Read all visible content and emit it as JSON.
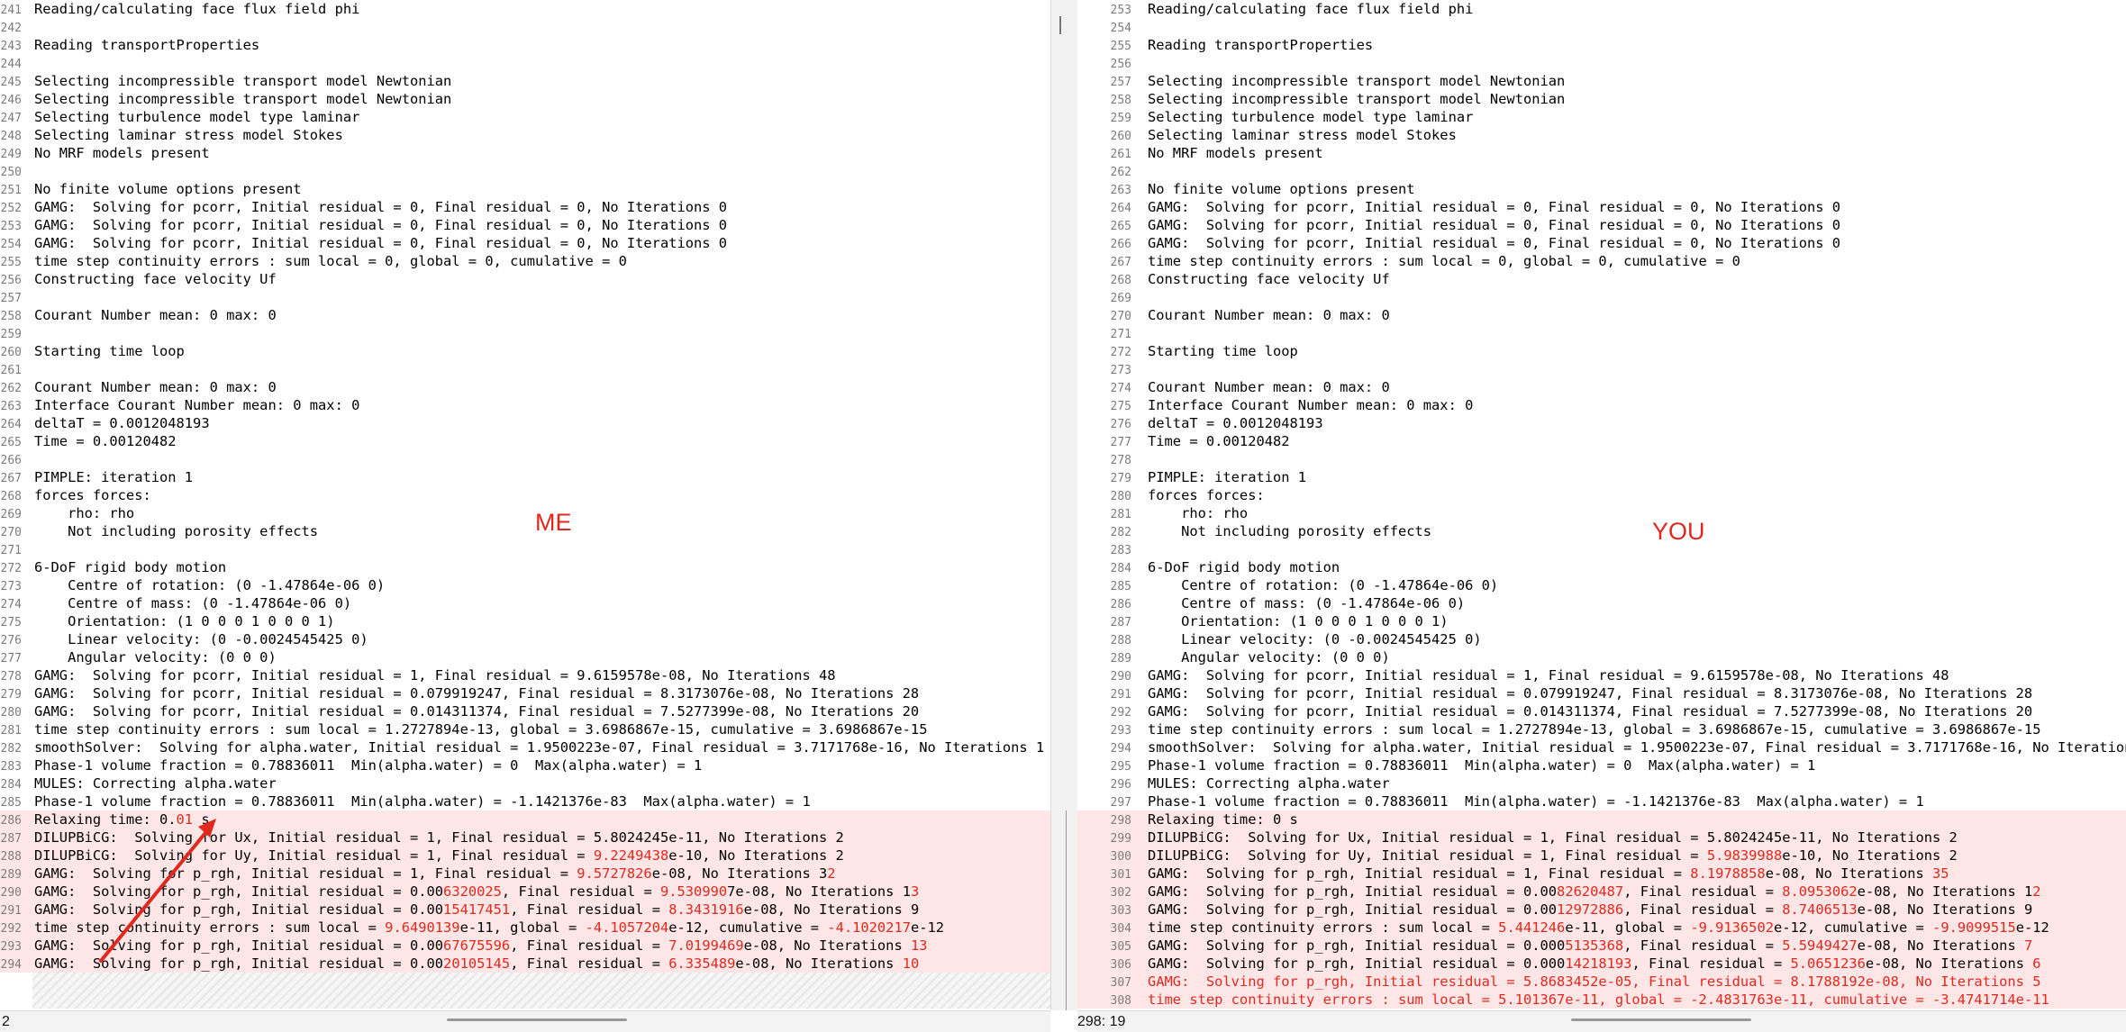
{
  "left": {
    "note": "ME",
    "status_text": "2",
    "lines": [
      {
        "n": "241",
        "text": "Reading/calculating face flux field phi"
      },
      {
        "n": "242",
        "text": ""
      },
      {
        "n": "243",
        "text": "Reading transportProperties"
      },
      {
        "n": "244",
        "text": ""
      },
      {
        "n": "245",
        "text": "Selecting incompressible transport model Newtonian"
      },
      {
        "n": "246",
        "text": "Selecting incompressible transport model Newtonian"
      },
      {
        "n": "247",
        "text": "Selecting turbulence model type laminar"
      },
      {
        "n": "248",
        "text": "Selecting laminar stress model Stokes"
      },
      {
        "n": "249",
        "text": "No MRF models present"
      },
      {
        "n": "250",
        "text": ""
      },
      {
        "n": "251",
        "text": "No finite volume options present"
      },
      {
        "n": "252",
        "text": "GAMG:  Solving for pcorr, Initial residual = 0, Final residual = 0, No Iterations 0"
      },
      {
        "n": "253",
        "text": "GAMG:  Solving for pcorr, Initial residual = 0, Final residual = 0, No Iterations 0"
      },
      {
        "n": "254",
        "text": "GAMG:  Solving for pcorr, Initial residual = 0, Final residual = 0, No Iterations 0"
      },
      {
        "n": "255",
        "text": "time step continuity errors : sum local = 0, global = 0, cumulative = 0"
      },
      {
        "n": "256",
        "text": "Constructing face velocity Uf"
      },
      {
        "n": "257",
        "text": ""
      },
      {
        "n": "258",
        "text": "Courant Number mean: 0 max: 0"
      },
      {
        "n": "259",
        "text": ""
      },
      {
        "n": "260",
        "text": "Starting time loop"
      },
      {
        "n": "261",
        "text": ""
      },
      {
        "n": "262",
        "text": "Courant Number mean: 0 max: 0"
      },
      {
        "n": "263",
        "text": "Interface Courant Number mean: 0 max: 0"
      },
      {
        "n": "264",
        "text": "deltaT = 0.0012048193"
      },
      {
        "n": "265",
        "text": "Time = 0.00120482"
      },
      {
        "n": "266",
        "text": ""
      },
      {
        "n": "267",
        "text": "PIMPLE: iteration 1"
      },
      {
        "n": "268",
        "text": "forces forces:"
      },
      {
        "n": "269",
        "text": "    rho: rho"
      },
      {
        "n": "270",
        "text": "    Not including porosity effects"
      },
      {
        "n": "271",
        "text": ""
      },
      {
        "n": "272",
        "text": "6-DoF rigid body motion"
      },
      {
        "n": "273",
        "text": "    Centre of rotation: (0 -1.47864e-06 0)"
      },
      {
        "n": "274",
        "text": "    Centre of mass: (0 -1.47864e-06 0)"
      },
      {
        "n": "275",
        "text": "    Orientation: (1 0 0 0 1 0 0 0 1)"
      },
      {
        "n": "276",
        "text": "    Linear velocity: (0 -0.0024545425 0)"
      },
      {
        "n": "277",
        "text": "    Angular velocity: (0 0 0)"
      },
      {
        "n": "278",
        "text": "GAMG:  Solving for pcorr, Initial residual = 1, Final residual = 9.6159578e-08, No Iterations 48"
      },
      {
        "n": "279",
        "text": "GAMG:  Solving for pcorr, Initial residual = 0.079919247, Final residual = 8.3173076e-08, No Iterations 28"
      },
      {
        "n": "280",
        "text": "GAMG:  Solving for pcorr, Initial residual = 0.014311374, Final residual = 7.5277399e-08, No Iterations 20"
      },
      {
        "n": "281",
        "text": "time step continuity errors : sum local = 1.2727894e-13, global = 3.6986867e-15, cumulative = 3.6986867e-15"
      },
      {
        "n": "282",
        "text": "smoothSolver:  Solving for alpha.water, Initial residual = 1.9500223e-07, Final residual = 3.7171768e-16, No Iterations 1"
      },
      {
        "n": "283",
        "text": "Phase-1 volume fraction = 0.78836011  Min(alpha.water) = 0  Max(alpha.water) = 1"
      },
      {
        "n": "284",
        "text": "MULES: Correcting alpha.water"
      },
      {
        "n": "285",
        "text": "Phase-1 volume fraction = 0.78836011  Min(alpha.water) = -1.1421376e-83  Max(alpha.water) = 1"
      },
      {
        "n": "286",
        "diff": true,
        "parts": [
          "Relaxing time: 0.",
          {
            "hl": "01"
          },
          " s"
        ]
      },
      {
        "n": "287",
        "diff": true,
        "text": "DILUPBiCG:  Solving for Ux, Initial residual = 1, Final residual = 5.8024245e-11, No Iterations 2"
      },
      {
        "n": "288",
        "diff": true,
        "parts": [
          "DILUPBiCG:  Solving for Uy, Initial residual = 1, Final residual = ",
          {
            "hl": "9.2249438"
          },
          "e-10, No Iterations 2"
        ]
      },
      {
        "n": "289",
        "diff": true,
        "parts": [
          "GAMG:  Solving for p_rgh, Initial residual = 1, Final residual = ",
          {
            "hl": "9.5727826"
          },
          "e-08, No Iterations 3",
          {
            "hl": "2"
          }
        ]
      },
      {
        "n": "290",
        "diff": true,
        "parts": [
          "GAMG:  Solving for p_rgh, Initial residual = 0.00",
          {
            "hl": "6320025"
          },
          ", Final residual = ",
          {
            "hl": "9.530990"
          },
          "7e-08, No Iterations 1",
          {
            "hl": "3"
          }
        ]
      },
      {
        "n": "291",
        "diff": true,
        "parts": [
          "GAMG:  Solving for p_rgh, Initial residual = 0.00",
          {
            "hl": "15417451"
          },
          ", Final residual = ",
          {
            "hl": "8.3431916"
          },
          "e-08, No Iterations 9"
        ]
      },
      {
        "n": "292",
        "diff": true,
        "parts": [
          "time step continuity errors : sum local = ",
          {
            "hl": "9.6490139"
          },
          "e-11, global = ",
          {
            "hl": "-4.1057204"
          },
          "e-12, cumulative = ",
          {
            "hl": "-4.1020217"
          },
          "e-12"
        ]
      },
      {
        "n": "293",
        "diff": true,
        "parts": [
          "GAMG:  Solving for p_rgh, Initial residual = 0.00",
          {
            "hl": "67675596"
          },
          ", Final residual = ",
          {
            "hl": "7.0199469"
          },
          "e-08, No Iterations ",
          {
            "hl": "13"
          }
        ]
      },
      {
        "n": "294",
        "diff": true,
        "parts": [
          "GAMG:  Solving for p_rgh, Initial residual = 0.00",
          {
            "hl": "20105145"
          },
          ", Final residual = ",
          {
            "hl": "6.335489"
          },
          "e-08, No Iterations ",
          {
            "hl": "10"
          }
        ]
      }
    ]
  },
  "right": {
    "note": "YOU",
    "status_text": "298: 19",
    "lines": [
      {
        "n": "253",
        "text": "Reading/calculating face flux field phi"
      },
      {
        "n": "254",
        "text": ""
      },
      {
        "n": "255",
        "text": "Reading transportProperties"
      },
      {
        "n": "256",
        "text": ""
      },
      {
        "n": "257",
        "text": "Selecting incompressible transport model Newtonian"
      },
      {
        "n": "258",
        "text": "Selecting incompressible transport model Newtonian"
      },
      {
        "n": "259",
        "text": "Selecting turbulence model type laminar"
      },
      {
        "n": "260",
        "text": "Selecting laminar stress model Stokes"
      },
      {
        "n": "261",
        "text": "No MRF models present"
      },
      {
        "n": "262",
        "text": ""
      },
      {
        "n": "263",
        "text": "No finite volume options present"
      },
      {
        "n": "264",
        "text": "GAMG:  Solving for pcorr, Initial residual = 0, Final residual = 0, No Iterations 0"
      },
      {
        "n": "265",
        "text": "GAMG:  Solving for pcorr, Initial residual = 0, Final residual = 0, No Iterations 0"
      },
      {
        "n": "266",
        "text": "GAMG:  Solving for pcorr, Initial residual = 0, Final residual = 0, No Iterations 0"
      },
      {
        "n": "267",
        "text": "time step continuity errors : sum local = 0, global = 0, cumulative = 0"
      },
      {
        "n": "268",
        "text": "Constructing face velocity Uf"
      },
      {
        "n": "269",
        "text": ""
      },
      {
        "n": "270",
        "text": "Courant Number mean: 0 max: 0"
      },
      {
        "n": "271",
        "text": ""
      },
      {
        "n": "272",
        "text": "Starting time loop"
      },
      {
        "n": "273",
        "text": ""
      },
      {
        "n": "274",
        "text": "Courant Number mean: 0 max: 0"
      },
      {
        "n": "275",
        "text": "Interface Courant Number mean: 0 max: 0"
      },
      {
        "n": "276",
        "text": "deltaT = 0.0012048193"
      },
      {
        "n": "277",
        "text": "Time = 0.00120482"
      },
      {
        "n": "278",
        "text": ""
      },
      {
        "n": "279",
        "text": "PIMPLE: iteration 1"
      },
      {
        "n": "280",
        "text": "forces forces:"
      },
      {
        "n": "281",
        "text": "    rho: rho"
      },
      {
        "n": "282",
        "text": "    Not including porosity effects"
      },
      {
        "n": "283",
        "text": ""
      },
      {
        "n": "284",
        "text": "6-DoF rigid body motion"
      },
      {
        "n": "285",
        "text": "    Centre of rotation: (0 -1.47864e-06 0)"
      },
      {
        "n": "286",
        "text": "    Centre of mass: (0 -1.47864e-06 0)"
      },
      {
        "n": "287",
        "text": "    Orientation: (1 0 0 0 1 0 0 0 1)"
      },
      {
        "n": "288",
        "text": "    Linear velocity: (0 -0.0024545425 0)"
      },
      {
        "n": "289",
        "text": "    Angular velocity: (0 0 0)"
      },
      {
        "n": "290",
        "text": "GAMG:  Solving for pcorr, Initial residual = 1, Final residual = 9.6159578e-08, No Iterations 48"
      },
      {
        "n": "291",
        "text": "GAMG:  Solving for pcorr, Initial residual = 0.079919247, Final residual = 8.3173076e-08, No Iterations 28"
      },
      {
        "n": "292",
        "text": "GAMG:  Solving for pcorr, Initial residual = 0.014311374, Final residual = 7.5277399e-08, No Iterations 20"
      },
      {
        "n": "293",
        "text": "time step continuity errors : sum local = 1.2727894e-13, global = 3.6986867e-15, cumulative = 3.6986867e-15"
      },
      {
        "n": "294",
        "text": "smoothSolver:  Solving for alpha.water, Initial residual = 1.9500223e-07, Final residual = 3.7171768e-16, No Iterations"
      },
      {
        "n": "295",
        "text": "Phase-1 volume fraction = 0.78836011  Min(alpha.water) = 0  Max(alpha.water) = 1"
      },
      {
        "n": "296",
        "text": "MULES: Correcting alpha.water"
      },
      {
        "n": "297",
        "text": "Phase-1 volume fraction = 0.78836011  Min(alpha.water) = -1.1421376e-83  Max(alpha.water) = 1"
      },
      {
        "n": "298",
        "diff": true,
        "text": "Relaxing time: 0 s"
      },
      {
        "n": "299",
        "diff": true,
        "text": "DILUPBiCG:  Solving for Ux, Initial residual = 1, Final residual = 5.8024245e-11, No Iterations 2"
      },
      {
        "n": "300",
        "diff": true,
        "parts": [
          "DILUPBiCG:  Solving for Uy, Initial residual = 1, Final residual = ",
          {
            "hl": "5.9839988"
          },
          "e-10, No Iterations 2"
        ]
      },
      {
        "n": "301",
        "diff": true,
        "parts": [
          "GAMG:  Solving for p_rgh, Initial residual = 1, Final residual = ",
          {
            "hl": "8.1978858"
          },
          "e-08, No Iterations ",
          {
            "hl": "35"
          }
        ]
      },
      {
        "n": "302",
        "diff": true,
        "parts": [
          "GAMG:  Solving for p_rgh, Initial residual = 0.00",
          {
            "hl": "82620487"
          },
          ", Final residual = ",
          {
            "hl": "8.0953062"
          },
          "e-08, No Iterations 1",
          {
            "hl": "2"
          }
        ]
      },
      {
        "n": "303",
        "diff": true,
        "parts": [
          "GAMG:  Solving for p_rgh, Initial residual = 0.00",
          {
            "hl": "12972886"
          },
          ", Final residual = ",
          {
            "hl": "8.7406513"
          },
          "e-08, No Iterations 9"
        ]
      },
      {
        "n": "304",
        "diff": true,
        "parts": [
          "time step continuity errors : sum local = ",
          {
            "hl": "5.441246"
          },
          "e-11, global = ",
          {
            "hl": "-9.9136502"
          },
          "e-12, cumulative = ",
          {
            "hl": "-9.9099515"
          },
          "e-12"
        ]
      },
      {
        "n": "305",
        "diff": true,
        "parts": [
          "GAMG:  Solving for p_rgh, Initial residual = 0.000",
          {
            "hl": "5135368"
          },
          ", Final residual = ",
          {
            "hl": "5.5949427"
          },
          "e-08, No Iterations ",
          {
            "hl": "7"
          }
        ]
      },
      {
        "n": "306",
        "diff": true,
        "parts": [
          "GAMG:  Solving for p_rgh, Initial residual = 0.000",
          {
            "hl": "14218193"
          },
          ", Final residual = ",
          {
            "hl": "5.0651236"
          },
          "e-08, No Iterations ",
          {
            "hl": "6"
          }
        ]
      },
      {
        "n": "307",
        "diff": true,
        "strong": true,
        "text": "GAMG:  Solving for p_rgh, Initial residual = 5.8683452e-05, Final residual = 8.1788192e-08, No Iterations 5"
      },
      {
        "n": "308",
        "diff": true,
        "strong": true,
        "text": "time step continuity errors : sum local = 5.101367e-11, global = -2.4831763e-11, cumulative = -3.4741714e-11"
      }
    ]
  },
  "colors": {
    "diff_bg": "#ffe6e6",
    "changed_text": "#e0281e",
    "annotation": "#e0281e"
  },
  "icons": [
    "scroll-marker-icon",
    "arrow-left-icon"
  ]
}
